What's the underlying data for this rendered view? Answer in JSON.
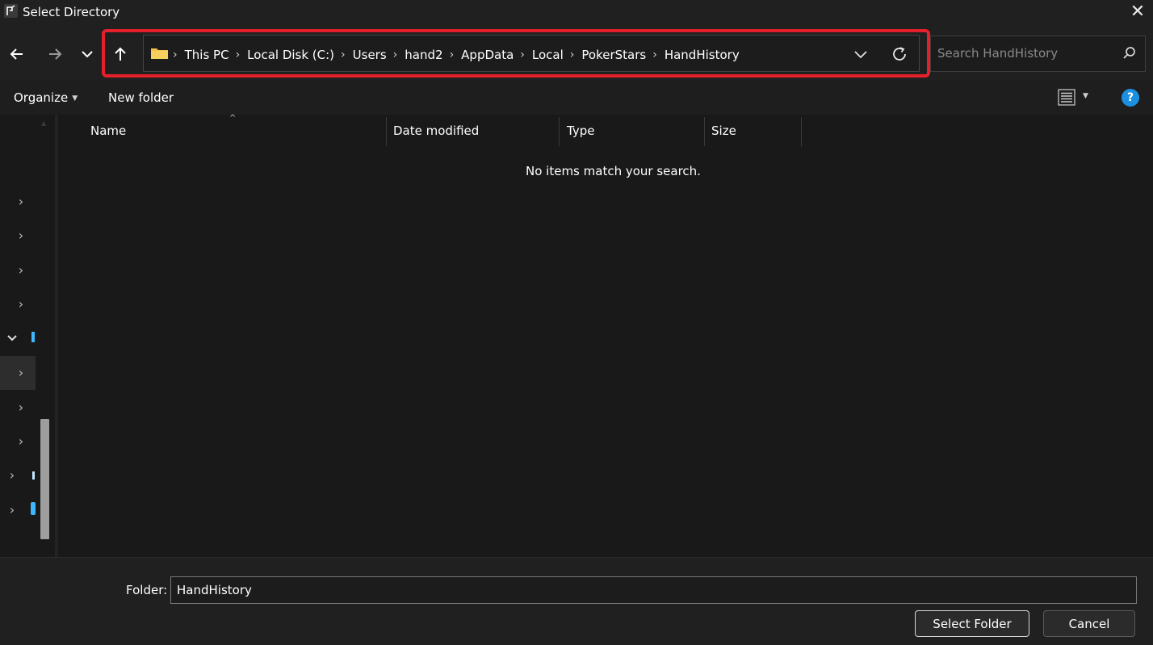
{
  "window": {
    "title": "Select Directory"
  },
  "address": {
    "crumbs": [
      "This PC",
      "Local Disk (C:)",
      "Users",
      "hand2",
      "AppData",
      "Local",
      "PokerStars",
      "HandHistory"
    ]
  },
  "search": {
    "placeholder": "Search HandHistory"
  },
  "toolbar": {
    "organize_label": "Organize",
    "new_folder_label": "New folder"
  },
  "file_list": {
    "columns": [
      "Name",
      "Date modified",
      "Type",
      "Size"
    ],
    "empty_message": "No items match your search."
  },
  "footer": {
    "folder_label": "Folder:",
    "folder_value": "HandHistory",
    "select_label": "Select Folder",
    "cancel_label": "Cancel"
  },
  "colors": {
    "highlight": "#e5202a",
    "help_blue": "#1d8fe1",
    "folder_yellow": "#f3c04a",
    "accent_cyan": "#3fb6ff"
  },
  "icons": {
    "back": "arrow-left-icon",
    "forward": "arrow-right-icon",
    "recent": "chevron-down-icon",
    "up": "arrow-up-icon",
    "folder": "folder-icon",
    "refresh": "refresh-icon",
    "search": "search-icon",
    "view": "view-details-icon",
    "help": "help-icon",
    "close": "close-icon"
  }
}
